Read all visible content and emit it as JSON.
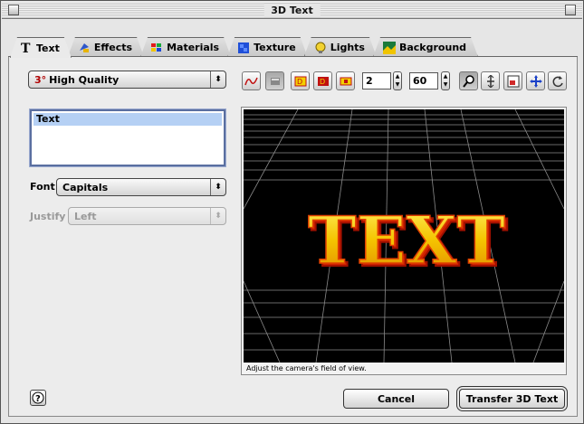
{
  "window": {
    "title": "3D Text"
  },
  "tabs": [
    {
      "label": "Text",
      "icon": "letter-t-icon",
      "active": true
    },
    {
      "label": "Effects",
      "icon": "effects-icon",
      "active": false
    },
    {
      "label": "Materials",
      "icon": "materials-icon",
      "active": false
    },
    {
      "label": "Texture",
      "icon": "texture-icon",
      "active": false
    },
    {
      "label": "Lights",
      "icon": "lightbulb-icon",
      "active": false
    },
    {
      "label": "Background",
      "icon": "landscape-icon",
      "active": false
    }
  ],
  "quality": {
    "prefix": "3°",
    "value": "High Quality"
  },
  "text_list": {
    "items": [
      "Text"
    ]
  },
  "font": {
    "label": "Font",
    "value": "Capitals"
  },
  "justify": {
    "label": "Justify",
    "value": "Left",
    "disabled": true
  },
  "toolbar": {
    "count_value": "2",
    "fov_value": "60",
    "buttons": [
      "curve-icon",
      "flat-render-icon",
      "render-preset-1-icon",
      "render-preset-2-icon",
      "render-preset-3-icon",
      "zoom-icon",
      "vertical-move-icon",
      "frame-icon",
      "pan-icon",
      "rotate-icon"
    ]
  },
  "preview": {
    "text": "TEXT",
    "caption": "Adjust the camera's field of view."
  },
  "buttons": {
    "cancel": "Cancel",
    "transfer": "Transfer 3D Text"
  },
  "colors": {
    "text_face": "#f5c400",
    "text_edge": "#d02000",
    "grid": "#8a8a8a"
  }
}
